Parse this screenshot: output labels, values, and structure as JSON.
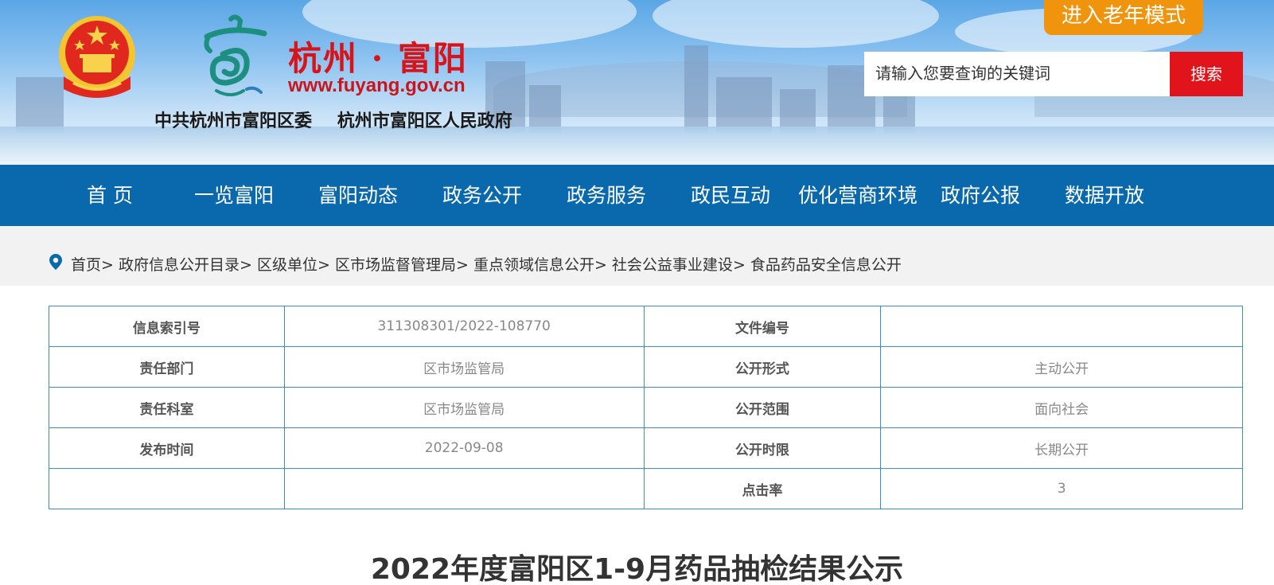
{
  "header": {
    "city_name": "杭州 · 富阳",
    "site_url": "www.fuyang.gov.cn",
    "org_committee": "中共杭州市富阳区委",
    "org_government": "杭州市富阳区人民政府",
    "elder_mode_label": "进入老年模式",
    "search_placeholder": "请输入您要查询的关键词",
    "search_button": "搜索"
  },
  "nav": {
    "items": [
      {
        "label": "首 页"
      },
      {
        "label": "一览富阳"
      },
      {
        "label": "富阳动态"
      },
      {
        "label": "政务公开"
      },
      {
        "label": "政务服务"
      },
      {
        "label": "政民互动"
      },
      {
        "label": "优化营商环境"
      },
      {
        "label": "政府公报"
      },
      {
        "label": "数据开放"
      }
    ]
  },
  "breadcrumb": {
    "items": [
      {
        "label": "首页"
      },
      {
        "label": "政府信息公开目录"
      },
      {
        "label": "区级单位"
      },
      {
        "label": "区市场监督管理局"
      },
      {
        "label": "重点领域信息公开"
      },
      {
        "label": "社会公益事业建设"
      },
      {
        "label": "食品药品安全信息公开"
      }
    ],
    "separator": ">"
  },
  "info": {
    "index_label": "信息索引号",
    "index_value": "311308301/2022-108770",
    "file_no_label": "文件编号",
    "file_no_value": "",
    "dept_label": "责任部门",
    "dept_value": "区市场监管局",
    "form_label": "公开形式",
    "form_value": "主动公开",
    "office_label": "责任科室",
    "office_value": "区市场监管局",
    "scope_label": "公开范围",
    "scope_value": "面向社会",
    "date_label": "发布时间",
    "date_value": "2022-09-08",
    "period_label": "公开时限",
    "period_value": "长期公开",
    "clicks_label": "点击率",
    "clicks_value": "3"
  },
  "article": {
    "title": "2022年度富阳区1-9月药品抽检结果公示"
  },
  "colors": {
    "nav_bg": "#0a68ad",
    "search_btn": "#e2141b",
    "elder_btn": "#f0930d",
    "table_border": "#3c8fc4"
  },
  "icons": [
    "national-emblem-icon",
    "fuyang-logo-icon",
    "location-pin-icon"
  ]
}
